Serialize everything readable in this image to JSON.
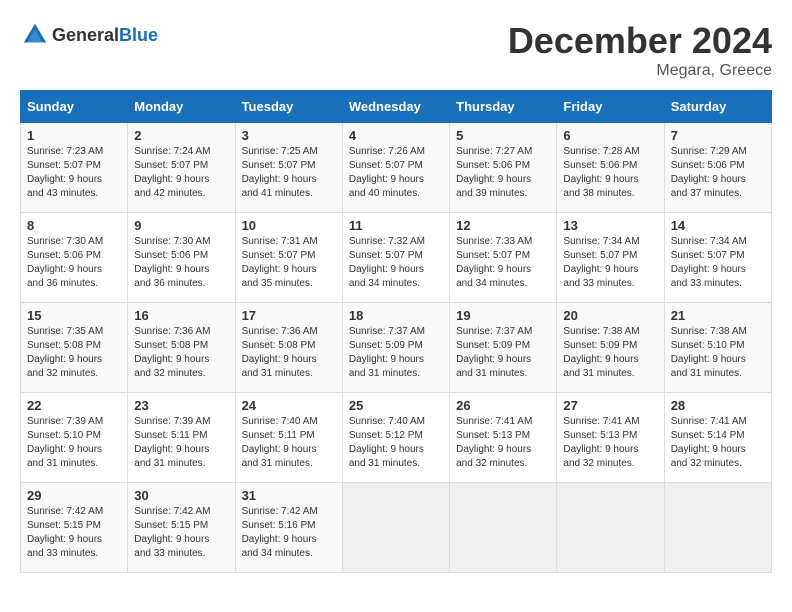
{
  "logo": {
    "general": "General",
    "blue": "Blue"
  },
  "title": "December 2024",
  "location": "Megara, Greece",
  "days_header": [
    "Sunday",
    "Monday",
    "Tuesday",
    "Wednesday",
    "Thursday",
    "Friday",
    "Saturday"
  ],
  "weeks": [
    [
      {
        "day": "1",
        "sunrise": "Sunrise: 7:23 AM",
        "sunset": "Sunset: 5:07 PM",
        "daylight": "Daylight: 9 hours and 43 minutes."
      },
      {
        "day": "2",
        "sunrise": "Sunrise: 7:24 AM",
        "sunset": "Sunset: 5:07 PM",
        "daylight": "Daylight: 9 hours and 42 minutes."
      },
      {
        "day": "3",
        "sunrise": "Sunrise: 7:25 AM",
        "sunset": "Sunset: 5:07 PM",
        "daylight": "Daylight: 9 hours and 41 minutes."
      },
      {
        "day": "4",
        "sunrise": "Sunrise: 7:26 AM",
        "sunset": "Sunset: 5:07 PM",
        "daylight": "Daylight: 9 hours and 40 minutes."
      },
      {
        "day": "5",
        "sunrise": "Sunrise: 7:27 AM",
        "sunset": "Sunset: 5:06 PM",
        "daylight": "Daylight: 9 hours and 39 minutes."
      },
      {
        "day": "6",
        "sunrise": "Sunrise: 7:28 AM",
        "sunset": "Sunset: 5:06 PM",
        "daylight": "Daylight: 9 hours and 38 minutes."
      },
      {
        "day": "7",
        "sunrise": "Sunrise: 7:29 AM",
        "sunset": "Sunset: 5:06 PM",
        "daylight": "Daylight: 9 hours and 37 minutes."
      }
    ],
    [
      {
        "day": "8",
        "sunrise": "Sunrise: 7:30 AM",
        "sunset": "Sunset: 5:06 PM",
        "daylight": "Daylight: 9 hours and 36 minutes."
      },
      {
        "day": "9",
        "sunrise": "Sunrise: 7:30 AM",
        "sunset": "Sunset: 5:06 PM",
        "daylight": "Daylight: 9 hours and 36 minutes."
      },
      {
        "day": "10",
        "sunrise": "Sunrise: 7:31 AM",
        "sunset": "Sunset: 5:07 PM",
        "daylight": "Daylight: 9 hours and 35 minutes."
      },
      {
        "day": "11",
        "sunrise": "Sunrise: 7:32 AM",
        "sunset": "Sunset: 5:07 PM",
        "daylight": "Daylight: 9 hours and 34 minutes."
      },
      {
        "day": "12",
        "sunrise": "Sunrise: 7:33 AM",
        "sunset": "Sunset: 5:07 PM",
        "daylight": "Daylight: 9 hours and 34 minutes."
      },
      {
        "day": "13",
        "sunrise": "Sunrise: 7:34 AM",
        "sunset": "Sunset: 5:07 PM",
        "daylight": "Daylight: 9 hours and 33 minutes."
      },
      {
        "day": "14",
        "sunrise": "Sunrise: 7:34 AM",
        "sunset": "Sunset: 5:07 PM",
        "daylight": "Daylight: 9 hours and 33 minutes."
      }
    ],
    [
      {
        "day": "15",
        "sunrise": "Sunrise: 7:35 AM",
        "sunset": "Sunset: 5:08 PM",
        "daylight": "Daylight: 9 hours and 32 minutes."
      },
      {
        "day": "16",
        "sunrise": "Sunrise: 7:36 AM",
        "sunset": "Sunset: 5:08 PM",
        "daylight": "Daylight: 9 hours and 32 minutes."
      },
      {
        "day": "17",
        "sunrise": "Sunrise: 7:36 AM",
        "sunset": "Sunset: 5:08 PM",
        "daylight": "Daylight: 9 hours and 31 minutes."
      },
      {
        "day": "18",
        "sunrise": "Sunrise: 7:37 AM",
        "sunset": "Sunset: 5:09 PM",
        "daylight": "Daylight: 9 hours and 31 minutes."
      },
      {
        "day": "19",
        "sunrise": "Sunrise: 7:37 AM",
        "sunset": "Sunset: 5:09 PM",
        "daylight": "Daylight: 9 hours and 31 minutes."
      },
      {
        "day": "20",
        "sunrise": "Sunrise: 7:38 AM",
        "sunset": "Sunset: 5:09 PM",
        "daylight": "Daylight: 9 hours and 31 minutes."
      },
      {
        "day": "21",
        "sunrise": "Sunrise: 7:38 AM",
        "sunset": "Sunset: 5:10 PM",
        "daylight": "Daylight: 9 hours and 31 minutes."
      }
    ],
    [
      {
        "day": "22",
        "sunrise": "Sunrise: 7:39 AM",
        "sunset": "Sunset: 5:10 PM",
        "daylight": "Daylight: 9 hours and 31 minutes."
      },
      {
        "day": "23",
        "sunrise": "Sunrise: 7:39 AM",
        "sunset": "Sunset: 5:11 PM",
        "daylight": "Daylight: 9 hours and 31 minutes."
      },
      {
        "day": "24",
        "sunrise": "Sunrise: 7:40 AM",
        "sunset": "Sunset: 5:11 PM",
        "daylight": "Daylight: 9 hours and 31 minutes."
      },
      {
        "day": "25",
        "sunrise": "Sunrise: 7:40 AM",
        "sunset": "Sunset: 5:12 PM",
        "daylight": "Daylight: 9 hours and 31 minutes."
      },
      {
        "day": "26",
        "sunrise": "Sunrise: 7:41 AM",
        "sunset": "Sunset: 5:13 PM",
        "daylight": "Daylight: 9 hours and 32 minutes."
      },
      {
        "day": "27",
        "sunrise": "Sunrise: 7:41 AM",
        "sunset": "Sunset: 5:13 PM",
        "daylight": "Daylight: 9 hours and 32 minutes."
      },
      {
        "day": "28",
        "sunrise": "Sunrise: 7:41 AM",
        "sunset": "Sunset: 5:14 PM",
        "daylight": "Daylight: 9 hours and 32 minutes."
      }
    ],
    [
      {
        "day": "29",
        "sunrise": "Sunrise: 7:42 AM",
        "sunset": "Sunset: 5:15 PM",
        "daylight": "Daylight: 9 hours and 33 minutes."
      },
      {
        "day": "30",
        "sunrise": "Sunrise: 7:42 AM",
        "sunset": "Sunset: 5:15 PM",
        "daylight": "Daylight: 9 hours and 33 minutes."
      },
      {
        "day": "31",
        "sunrise": "Sunrise: 7:42 AM",
        "sunset": "Sunset: 5:16 PM",
        "daylight": "Daylight: 9 hours and 34 minutes."
      },
      null,
      null,
      null,
      null
    ]
  ]
}
